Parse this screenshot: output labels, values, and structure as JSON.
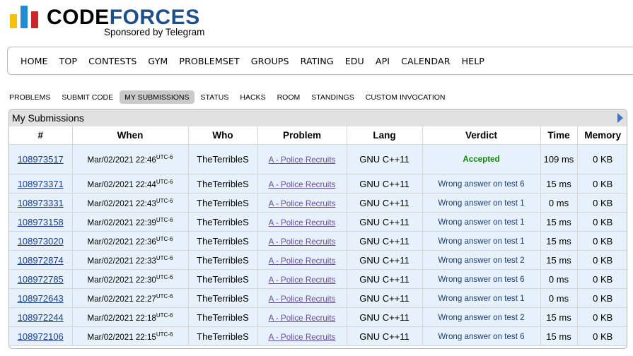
{
  "header": {
    "brand_code": "CODE",
    "brand_forces": "FORCES",
    "sponsor": "Sponsored by Telegram"
  },
  "top_menu": [
    "HOME",
    "TOP",
    "CONTESTS",
    "GYM",
    "PROBLEMSET",
    "GROUPS",
    "RATING",
    "EDU",
    "API",
    "CALENDAR",
    "HELP"
  ],
  "second_menu": [
    {
      "label": "PROBLEMS",
      "active": false
    },
    {
      "label": "SUBMIT CODE",
      "active": false
    },
    {
      "label": "MY SUBMISSIONS",
      "active": true
    },
    {
      "label": "STATUS",
      "active": false
    },
    {
      "label": "HACKS",
      "active": false
    },
    {
      "label": "ROOM",
      "active": false
    },
    {
      "label": "STANDINGS",
      "active": false
    },
    {
      "label": "CUSTOM INVOCATION",
      "active": false
    }
  ],
  "submissions": {
    "title": "My Submissions",
    "columns": [
      "#",
      "When",
      "Who",
      "Problem",
      "Lang",
      "Verdict",
      "Time",
      "Memory"
    ],
    "timezone": "UTC-6",
    "rows": [
      {
        "id": "108973517",
        "when": "Mar/02/2021 22:46",
        "who": "TheTerribleS",
        "problem": "A - Police Recruits",
        "lang": "GNU C++11",
        "verdict": "Accepted",
        "accepted": true,
        "time": "109 ms",
        "memory": "0 KB"
      },
      {
        "id": "108973371",
        "when": "Mar/02/2021 22:44",
        "who": "TheTerribleS",
        "problem": "A - Police Recruits",
        "lang": "GNU C++11",
        "verdict": "Wrong answer on test 6",
        "accepted": false,
        "time": "15 ms",
        "memory": "0 KB"
      },
      {
        "id": "108973331",
        "when": "Mar/02/2021 22:43",
        "who": "TheTerribleS",
        "problem": "A - Police Recruits",
        "lang": "GNU C++11",
        "verdict": "Wrong answer on test 1",
        "accepted": false,
        "time": "0 ms",
        "memory": "0 KB"
      },
      {
        "id": "108973158",
        "when": "Mar/02/2021 22:39",
        "who": "TheTerribleS",
        "problem": "A - Police Recruits",
        "lang": "GNU C++11",
        "verdict": "Wrong answer on test 1",
        "accepted": false,
        "time": "15 ms",
        "memory": "0 KB"
      },
      {
        "id": "108973020",
        "when": "Mar/02/2021 22:36",
        "who": "TheTerribleS",
        "problem": "A - Police Recruits",
        "lang": "GNU C++11",
        "verdict": "Wrong answer on test 1",
        "accepted": false,
        "time": "15 ms",
        "memory": "0 KB"
      },
      {
        "id": "108972874",
        "when": "Mar/02/2021 22:33",
        "who": "TheTerribleS",
        "problem": "A - Police Recruits",
        "lang": "GNU C++11",
        "verdict": "Wrong answer on test 2",
        "accepted": false,
        "time": "15 ms",
        "memory": "0 KB"
      },
      {
        "id": "108972785",
        "when": "Mar/02/2021 22:30",
        "who": "TheTerribleS",
        "problem": "A - Police Recruits",
        "lang": "GNU C++11",
        "verdict": "Wrong answer on test 6",
        "accepted": false,
        "time": "0 ms",
        "memory": "0 KB"
      },
      {
        "id": "108972643",
        "when": "Mar/02/2021 22:27",
        "who": "TheTerribleS",
        "problem": "A - Police Recruits",
        "lang": "GNU C++11",
        "verdict": "Wrong answer on test 1",
        "accepted": false,
        "time": "0 ms",
        "memory": "0 KB"
      },
      {
        "id": "108972244",
        "when": "Mar/02/2021 22:18",
        "who": "TheTerribleS",
        "problem": "A - Police Recruits",
        "lang": "GNU C++11",
        "verdict": "Wrong answer on test 2",
        "accepted": false,
        "time": "15 ms",
        "memory": "0 KB"
      },
      {
        "id": "108972106",
        "when": "Mar/02/2021 22:15",
        "who": "TheTerribleS",
        "problem": "A - Police Recruits",
        "lang": "GNU C++11",
        "verdict": "Wrong answer on test 6",
        "accepted": false,
        "time": "15 ms",
        "memory": "0 KB"
      }
    ]
  }
}
